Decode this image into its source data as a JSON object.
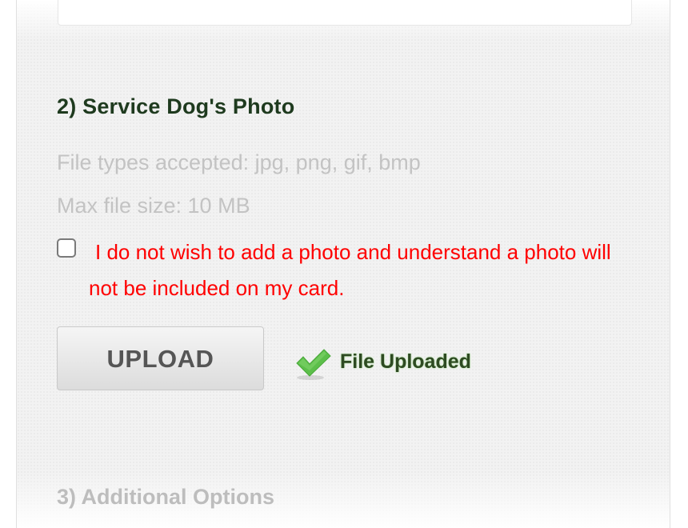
{
  "section": {
    "title": "2) Service Dog's Photo",
    "file_types": "File types accepted: jpg, png, gif, bmp",
    "max_size": "Max file size: 10 MB"
  },
  "optout": {
    "checked": false,
    "label": "I do not wish to add a photo and understand a photo will not be included on my card."
  },
  "upload": {
    "button_label": "UPLOAD",
    "status_text": "File Uploaded",
    "status_icon": "checkmark-icon"
  },
  "next_section": {
    "title": "3) Additional Options"
  },
  "colors": {
    "title": "#1e3a1e",
    "hint": "#c3c3c3",
    "warning": "#ff0000",
    "check": "#5cbf4a",
    "status_text": "#2e4a22"
  }
}
